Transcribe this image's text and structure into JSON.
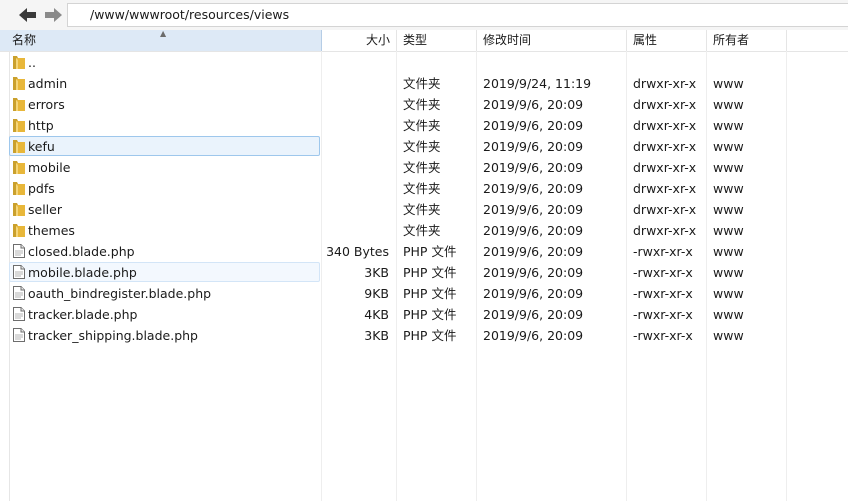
{
  "toolbar": {
    "path": "/www/wwwroot/resources/views"
  },
  "columns": {
    "name": "名称",
    "size": "大小",
    "type": "类型",
    "modified": "修改时间",
    "permissions": "属性",
    "owner": "所有者"
  },
  "files": [
    {
      "name": "..",
      "size": "",
      "type": "",
      "modified": "",
      "permissions": "",
      "owner": "",
      "kind": "folder"
    },
    {
      "name": "admin",
      "size": "",
      "type": "文件夹",
      "modified": "2019/9/24, 11:19",
      "permissions": "drwxr-xr-x",
      "owner": "www",
      "kind": "folder"
    },
    {
      "name": "errors",
      "size": "",
      "type": "文件夹",
      "modified": "2019/9/6, 20:09",
      "permissions": "drwxr-xr-x",
      "owner": "www",
      "kind": "folder"
    },
    {
      "name": "http",
      "size": "",
      "type": "文件夹",
      "modified": "2019/9/6, 20:09",
      "permissions": "drwxr-xr-x",
      "owner": "www",
      "kind": "folder"
    },
    {
      "name": "kefu",
      "size": "",
      "type": "文件夹",
      "modified": "2019/9/6, 20:09",
      "permissions": "drwxr-xr-x",
      "owner": "www",
      "kind": "folder",
      "state": "selected"
    },
    {
      "name": "mobile",
      "size": "",
      "type": "文件夹",
      "modified": "2019/9/6, 20:09",
      "permissions": "drwxr-xr-x",
      "owner": "www",
      "kind": "folder"
    },
    {
      "name": "pdfs",
      "size": "",
      "type": "文件夹",
      "modified": "2019/9/6, 20:09",
      "permissions": "drwxr-xr-x",
      "owner": "www",
      "kind": "folder"
    },
    {
      "name": "seller",
      "size": "",
      "type": "文件夹",
      "modified": "2019/9/6, 20:09",
      "permissions": "drwxr-xr-x",
      "owner": "www",
      "kind": "folder"
    },
    {
      "name": "themes",
      "size": "",
      "type": "文件夹",
      "modified": "2019/9/6, 20:09",
      "permissions": "drwxr-xr-x",
      "owner": "www",
      "kind": "folder"
    },
    {
      "name": "closed.blade.php",
      "size": "340 Bytes",
      "type": "PHP 文件",
      "modified": "2019/9/6, 20:09",
      "permissions": "-rwxr-xr-x",
      "owner": "www",
      "kind": "file"
    },
    {
      "name": "mobile.blade.php",
      "size": "3KB",
      "type": "PHP 文件",
      "modified": "2019/9/6, 20:09",
      "permissions": "-rwxr-xr-x",
      "owner": "www",
      "kind": "file",
      "state": "hover"
    },
    {
      "name": "oauth_bindregister.blade.php",
      "size": "9KB",
      "type": "PHP 文件",
      "modified": "2019/9/6, 20:09",
      "permissions": "-rwxr-xr-x",
      "owner": "www",
      "kind": "file"
    },
    {
      "name": "tracker.blade.php",
      "size": "4KB",
      "type": "PHP 文件",
      "modified": "2019/9/6, 20:09",
      "permissions": "-rwxr-xr-x",
      "owner": "www",
      "kind": "file"
    },
    {
      "name": "tracker_shipping.blade.php",
      "size": "3KB",
      "type": "PHP 文件",
      "modified": "2019/9/6, 20:09",
      "permissions": "-rwxr-xr-x",
      "owner": "www",
      "kind": "file"
    }
  ],
  "colors": {
    "folder": "#e8b73a",
    "selection_border": "#9ec7ec",
    "selection_fill": "#eaf3fc",
    "header_sorted": "#dde9f6"
  }
}
